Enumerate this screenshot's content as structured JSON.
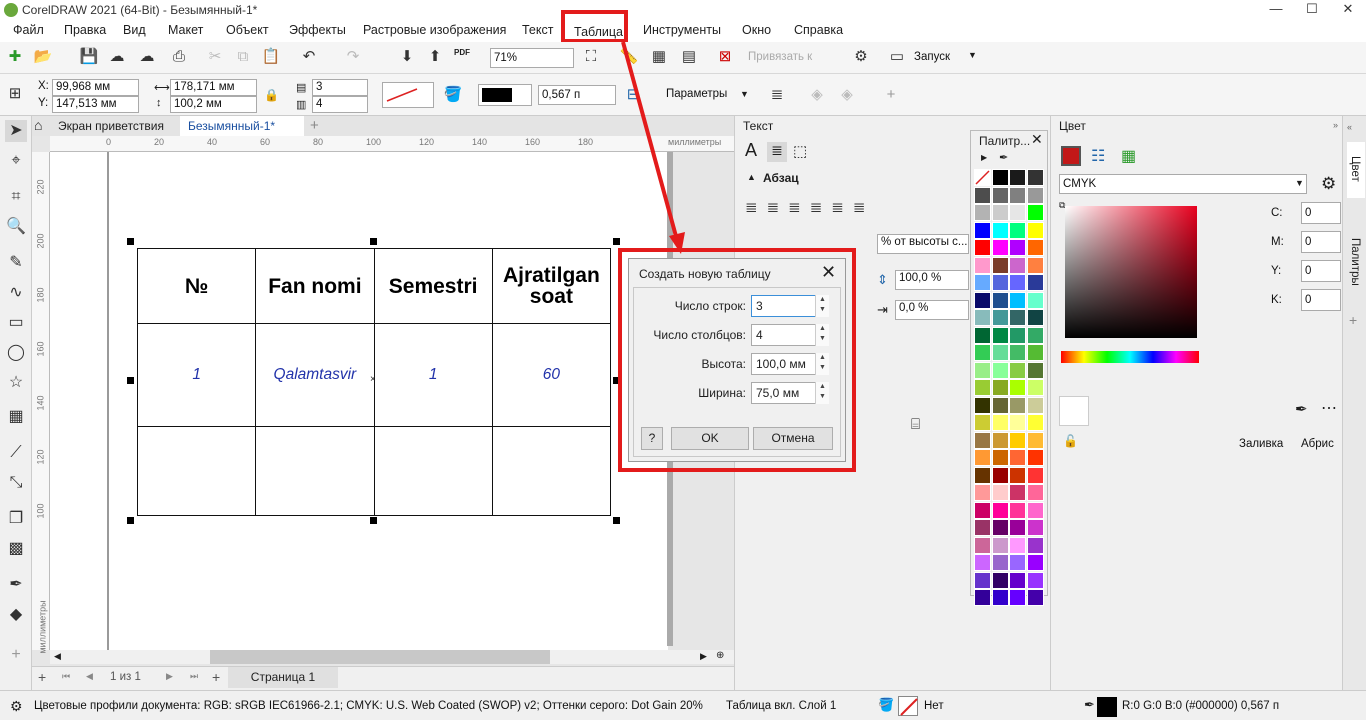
{
  "window": {
    "title": "CorelDRAW 2021 (64-Bit) - Безымянный-1*",
    "minimize": "—",
    "maximize": "☐",
    "close": "✕"
  },
  "menu": [
    "Файл",
    "Правка",
    "Вид",
    "Макет",
    "Объект",
    "Эффекты",
    "Растровые изображения",
    "Текст",
    "Таблица",
    "Инструменты",
    "Окно",
    "Справка"
  ],
  "toolbar": {
    "zoom": "71%",
    "snap_label": "Привязать к",
    "launch_label": "Запуск",
    "pdf_label": "PDF"
  },
  "propbar": {
    "x_label": "X:",
    "x_value": "99,968 мм",
    "y_label": "Y:",
    "y_value": "147,513 мм",
    "w_value": "178,171 мм",
    "h_value": "100,2 мм",
    "rows_value": "3",
    "cols_value": "4",
    "outline_width": "0,567 п",
    "params_label": "Параметры"
  },
  "tabs": {
    "welcome": "Экран приветствия",
    "doc": "Безымянный-1*",
    "add": "+"
  },
  "ruler": {
    "units": "миллиметры",
    "h_ticks": [
      "0",
      "20",
      "40",
      "60",
      "80",
      "100",
      "120",
      "140",
      "160",
      "180"
    ],
    "v_ticks": [
      "220",
      "200",
      "180",
      "160",
      "140",
      "120",
      "100"
    ],
    "v_units": "миллиметры"
  },
  "table": {
    "headers": [
      "№",
      "Fan nomi",
      "Semestri",
      "Ajratilgan soat"
    ],
    "rows": [
      [
        "1",
        "Qalamtasvir",
        "1",
        "60"
      ],
      [
        "",
        "",
        "",
        ""
      ]
    ]
  },
  "pagebar": {
    "page_count": "1 из 1",
    "page_tab": "Страница 1"
  },
  "dialog": {
    "title": "Создать новую таблицу",
    "rows_label": "Число строк:",
    "rows_value": "3",
    "cols_label": "Число столбцов:",
    "cols_value": "4",
    "height_label": "Высота:",
    "height_value": "100,0 мм",
    "width_label": "Ширина:",
    "width_value": "75,0 мм",
    "help_label": "?",
    "ok_label": "OK",
    "cancel_label": "Отмена"
  },
  "text_docker": {
    "title": "Текст",
    "paragraph": "Абзац",
    "line_spacing_unit": "% от высоты с...",
    "spacing_value": "100,0 %",
    "indent_value": "0,0 %"
  },
  "palette": {
    "title": "Палитр...",
    "colors": [
      "#ffffff",
      "#000000",
      "#1a1a1a",
      "#333333",
      "#4d4d4d",
      "#666666",
      "#808080",
      "#999999",
      "#b3b3b3",
      "#cccccc",
      "#e6e6e6",
      "#00ff00",
      "#0000ff",
      "#00ffff",
      "#00ff7f",
      "#ffff00",
      "#ff0000",
      "#ff00ff",
      "#b000ff",
      "#ff6600",
      "#ff99cc",
      "#7a3d2a",
      "#cc66cc",
      "#ff8040",
      "#66aaff",
      "#5566dd",
      "#6666ff",
      "#2a3a99",
      "#0a0a6a",
      "#1f4f8f",
      "#00bfff",
      "#66ffcc",
      "#88bbbb",
      "#449999",
      "#336666",
      "#114444",
      "#006633",
      "#008844",
      "#229966",
      "#33aa66",
      "#33cc55",
      "#66dd99",
      "#44bb66",
      "#55bb33",
      "#99ee88",
      "#88ff99",
      "#88cc44",
      "#557733",
      "#99cc33",
      "#88aa22",
      "#aaff00",
      "#ccff66",
      "#333300",
      "#666633",
      "#999966",
      "#cccc99",
      "#cccc33",
      "#ffff66",
      "#ffff99",
      "#ffff33",
      "#997744",
      "#cc9933",
      "#ffcc00",
      "#ffbb33",
      "#ff9933",
      "#cc6600",
      "#ff6633",
      "#ff3300",
      "#663300",
      "#990000",
      "#cc3300",
      "#ff3333",
      "#ff9999",
      "#ffcccc",
      "#cc3366",
      "#ff6699",
      "#cc0066",
      "#ff0099",
      "#ff3399",
      "#ff66cc",
      "#993366",
      "#660066",
      "#990099",
      "#cc33cc",
      "#cc6699",
      "#cc99cc",
      "#ff99ff",
      "#9933cc",
      "#cc66ff",
      "#9966cc",
      "#9966ff",
      "#9900ff",
      "#6633cc",
      "#330066",
      "#6600cc",
      "#9933ff",
      "#330099",
      "#3300cc",
      "#6600ff",
      "#4400aa"
    ]
  },
  "color_docker": {
    "title": "Цвет",
    "model": "CMYK",
    "c_label": "C:",
    "c_value": "0",
    "m_label": "M:",
    "m_value": "0",
    "y_label": "Y:",
    "y_value": "0",
    "k_label": "K:",
    "k_value": "0",
    "fill_label": "Заливка",
    "outline_label": "Абрис"
  },
  "side_tabs": {
    "color": "Цвет",
    "palettes": "Палитры"
  },
  "status": {
    "profiles": "Цветовые профили документа: RGB: sRGB IEC61966-2.1; CMYK: U.S. Web Coated (SWOP) v2; Оттенки серого: Dot Gain 20%",
    "object_info": "Таблица вкл. Слой 1",
    "fill_none": "Нет",
    "outline_info": "R:0 G:0 B:0 (#000000)  0,567 п"
  },
  "colors": {
    "highlight": "#e31b1b",
    "table_text": "#2233aa"
  }
}
